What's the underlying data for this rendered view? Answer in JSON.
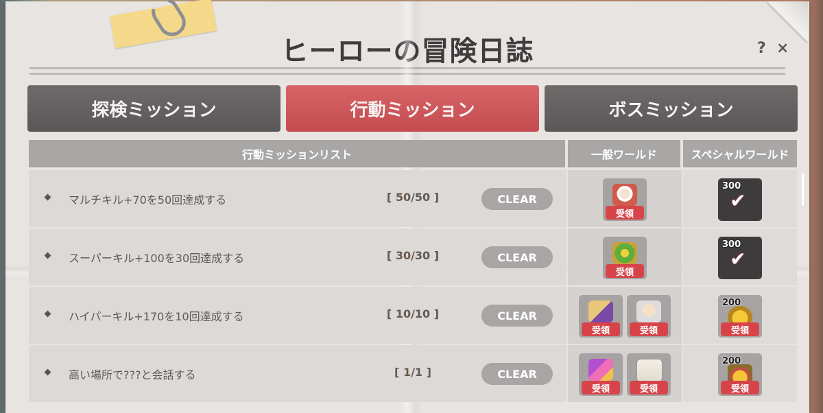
{
  "window": {
    "title": "ヒーローの冒険日誌",
    "help_label": "?",
    "close_label": "×"
  },
  "tabs": [
    {
      "label": "探検ミッション",
      "active": false
    },
    {
      "label": "行動ミッション",
      "active": true
    },
    {
      "label": "ボスミッション",
      "active": false
    }
  ],
  "table": {
    "headers": {
      "list": "行動ミッションリスト",
      "general": "一般ワールド",
      "special": "スペシャルワールド"
    },
    "rows": [
      {
        "mission": "マルチキル+70を50回達成する",
        "progress_open": "[ ",
        "current": "50",
        "sep": "/",
        "total": "50",
        "progress_close": " ]",
        "clear": "CLEAR",
        "general_rewards": [
          {
            "icon": "portrait-icon",
            "label": "受領"
          }
        ],
        "special_reward": {
          "icon": "check-icon",
          "amount": "300"
        }
      },
      {
        "mission": "スーパーキル+100を30回達成する",
        "progress_open": "[ ",
        "current": "30",
        "sep": "/",
        "total": "30",
        "progress_close": " ]",
        "clear": "CLEAR",
        "general_rewards": [
          {
            "icon": "gift-box-icon",
            "label": "受領"
          }
        ],
        "special_reward": {
          "icon": "check-icon",
          "amount": "300"
        }
      },
      {
        "mission": "ハイパーキル+170を10回達成する",
        "progress_open": "[ ",
        "current": "10",
        "sep": "/",
        "total": "10",
        "progress_close": " ]",
        "clear": "CLEAR",
        "general_rewards": [
          {
            "icon": "scroll-icon",
            "label": "受領"
          },
          {
            "icon": "bald-face-icon",
            "label": "受領"
          }
        ],
        "special_reward": {
          "icon": "coin-bag-icon",
          "amount": "200",
          "label": "受領"
        }
      },
      {
        "mission": "高い場所で???と会話する",
        "progress_open": "[ ",
        "current": "1",
        "sep": "/",
        "total": "1",
        "progress_close": " ]",
        "clear": "CLEAR",
        "general_rewards": [
          {
            "icon": "magic-wand-icon",
            "label": "受領"
          },
          {
            "icon": "id-card-icon",
            "label": "受領"
          }
        ],
        "special_reward": {
          "icon": "treasure-pile-icon",
          "amount": "200",
          "label": "受領"
        }
      }
    ]
  },
  "colors": {
    "active_tab": "#c9555a",
    "inactive_tab": "#626060",
    "receive_button": "#d6444a",
    "header": "#a9a6a6"
  }
}
